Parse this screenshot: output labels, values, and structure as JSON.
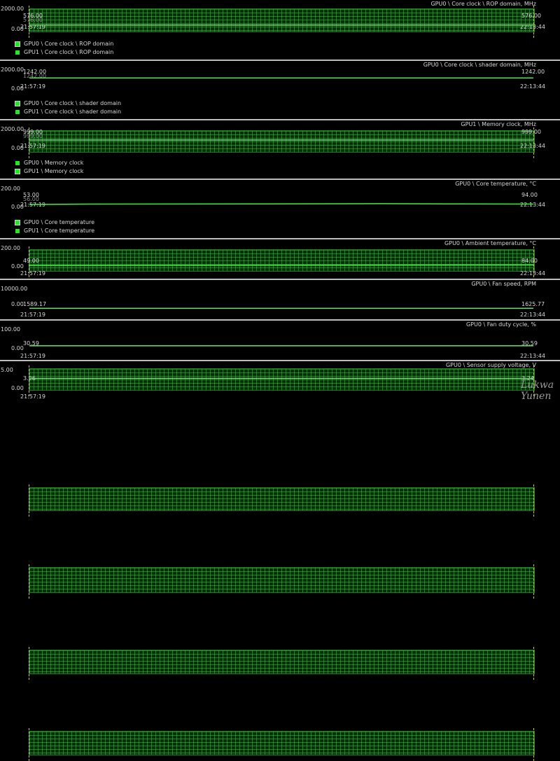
{
  "panels": [
    {
      "title": "GPU0 \\ Core clock \\ ROP domain, MHz",
      "ymax": "2000.00",
      "ymin": "0.00",
      "left_value": "576.00",
      "right_value": "576.00",
      "overlap_value": "576.00",
      "t_start": "21:57:19",
      "t_end": "22:13:44",
      "legend": [
        {
          "label": "GPU0 \\ Core clock \\ ROP domain",
          "boxed": true
        },
        {
          "label": "GPU1 \\ Core clock \\ ROP domain",
          "boxed": false
        }
      ]
    },
    {
      "title": "GPU0 \\ Core clock \\ shader domain, MHz",
      "ymax": "2000.00",
      "ymin": "0.00",
      "left_value": "1242.00",
      "right_value": "1242.00",
      "overlap_value": "1242.00",
      "t_start": "21:57:19",
      "t_end": "22:13:44",
      "legend": [
        {
          "label": "GPU0 \\ Core clock \\ shader domain",
          "boxed": true
        },
        {
          "label": "GPU1 \\ Core clock \\ shader domain",
          "boxed": false
        }
      ]
    },
    {
      "title": "GPU1 \\ Memory clock, MHz",
      "ymax": "2000.00",
      "ymin": "0.00",
      "left_value": "999.00",
      "right_value": "999.00",
      "overlap_value": "999.00",
      "t_start": "21:57:19",
      "t_end": "22:13:44",
      "legend": [
        {
          "label": "GPU0 \\ Memory clock",
          "boxed": false
        },
        {
          "label": "GPU1 \\ Memory clock",
          "boxed": true
        }
      ]
    },
    {
      "title": "GPU0 \\ Core temperature, °C",
      "ymax": "200.00",
      "ymin": "0.00",
      "left_value": "53.00",
      "right_value": "94.00",
      "overlap_value": "56.00",
      "t_start": "21:57:19",
      "t_end": "22:13:44",
      "legend": [
        {
          "label": "GPU0 \\ Core temperature",
          "boxed": true
        },
        {
          "label": "GPU1 \\ Core temperature",
          "boxed": false
        }
      ]
    },
    {
      "title": "GPU0 \\ Ambient temperature, °C",
      "ymax": "200.00",
      "ymin": "0.00",
      "left_value": "49.00",
      "right_value": "84.00",
      "overlap_value": "",
      "t_start": "21:57:19",
      "t_end": "22:13:44",
      "legend": []
    },
    {
      "title": "GPU0 \\ Fan speed, RPM",
      "ymax": "10000.00",
      "ymin": "0.00",
      "left_value": "1589.17",
      "right_value": "1625.77",
      "overlap_value": "",
      "t_start": "21:57:19",
      "t_end": "22:13:44",
      "legend": []
    },
    {
      "title": "GPU0 \\ Fan duty cycle, %",
      "ymax": "100.00",
      "ymin": "0.00",
      "left_value": "30.59",
      "right_value": "30.59",
      "overlap_value": "",
      "t_start": "21:57:19",
      "t_end": "22:13:44",
      "legend": []
    },
    {
      "title": "GPU0 \\ Sensor supply voltage, V",
      "ymax": "5.00",
      "ymin": "0.00",
      "left_value": "3.26",
      "right_value": "3.24",
      "overlap_value": "",
      "t_start": "21:57:19",
      "t_end": "",
      "legend": []
    }
  ],
  "series": [
    {
      "panel": 0,
      "level": 576,
      "max": 2000,
      "color": "#6ee26e"
    },
    {
      "panel": 1,
      "level": 1242,
      "max": 2000,
      "color": "#6ee26e"
    },
    {
      "panel": 2,
      "level": 999,
      "max": 2000,
      "color": "#6ee26e"
    },
    {
      "panel": 3,
      "level": 57,
      "max": 200,
      "color": "#3ef03e",
      "trend": [
        [
          0,
          53
        ],
        [
          0.12,
          57
        ],
        [
          0.45,
          58
        ],
        [
          0.7,
          61
        ],
        [
          0.85,
          58
        ],
        [
          1,
          57
        ]
      ]
    },
    {
      "panel": 4,
      "level": 49,
      "max": 200,
      "color": "#3ef03e",
      "trend": [
        [
          0,
          48
        ],
        [
          0.35,
          50
        ],
        [
          0.65,
          52
        ],
        [
          1,
          53
        ]
      ]
    },
    {
      "panel": 5,
      "level": 1589.17,
      "max": 10000,
      "color": "#6ee26e"
    },
    {
      "panel": 6,
      "level": 30.59,
      "max": 100,
      "color": "#6ee26e"
    },
    {
      "panel": 7,
      "level": 3.26,
      "max": 5,
      "color": "#6ee26e"
    }
  ],
  "watermark": "Lukwa Yunen",
  "accent_colors": {
    "background": "#000000",
    "grid": "#3cbe3c",
    "text": "#d8d8d8",
    "cursor": "#c8c85a"
  }
}
